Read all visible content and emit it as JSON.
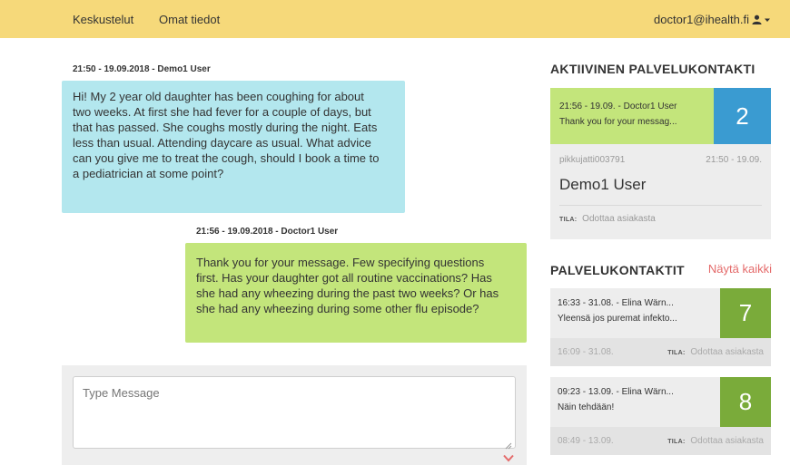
{
  "nav": {
    "links": [
      "Keskustelut",
      "Omat tiedot"
    ],
    "user_email": "doctor1@ihealth.fi",
    "user_icon": "user-icon",
    "caret_icon": "caret-down-icon"
  },
  "chat": {
    "messages": [
      {
        "meta": "21:50 - 19.09.2018 - Demo1 User",
        "lines": [
          "Hi! My 2 year old daughter has been coughing for about",
          "two weeks. At first she had fever for a couple of days, but",
          "that has passed. She coughs mostly during the night. Eats",
          "less than usual. Attending daycare as usual. What advice",
          "can you give me to treat the cough, should I book a time to",
          "a pediatrician at some point?"
        ]
      },
      {
        "meta": "21:56 - 19.09.2018 - Doctor1 User",
        "lines": [
          "Thank you for your message. Few specifying questions",
          "first. Has your daughter got all routine vaccinations? Has",
          "she had any wheezing during the past two weeks? Or has",
          "she had any wheezing during some other flu episode?"
        ]
      }
    ],
    "compose_placeholder": "Type Message"
  },
  "active": {
    "title": "AKTIIVINEN PALVELUKONTAKTI",
    "head_meta": "21:56 - 19.09. - Doctor1 User",
    "head_preview": "Thank you for your messag...",
    "count": "2",
    "id": "pikkujatti003791",
    "time": "21:50 - 19.09.",
    "patient": "Demo1 User",
    "status_label": "TILA:",
    "status": "Odottaa asiakasta"
  },
  "contacts": {
    "title": "PALVELUKONTAKTIT",
    "show_all": "Näytä kaikki",
    "items": [
      {
        "meta": "16:33 - 31.08. - Elina Wärn...",
        "preview": "Yleensä jos puremat infekto...",
        "count": "7",
        "time": "16:09 - 31.08.",
        "status_label": "TILA:",
        "status": "Odottaa asiakasta"
      },
      {
        "meta": "09:23 - 13.09. - Elina Wärn...",
        "preview": "Näin tehdään!",
        "count": "8",
        "time": "08:49 - 13.09.",
        "status_label": "TILA:",
        "status": "Odottaa asiakasta"
      }
    ]
  },
  "colors": {
    "topbar": "#f6d97a",
    "incoming_bubble": "#b3e7ee",
    "outgoing_bubble": "#c3e57b",
    "active_count": "#3a9bd1",
    "contact_count": "#7aab3a",
    "link_red": "#e46a6a"
  }
}
